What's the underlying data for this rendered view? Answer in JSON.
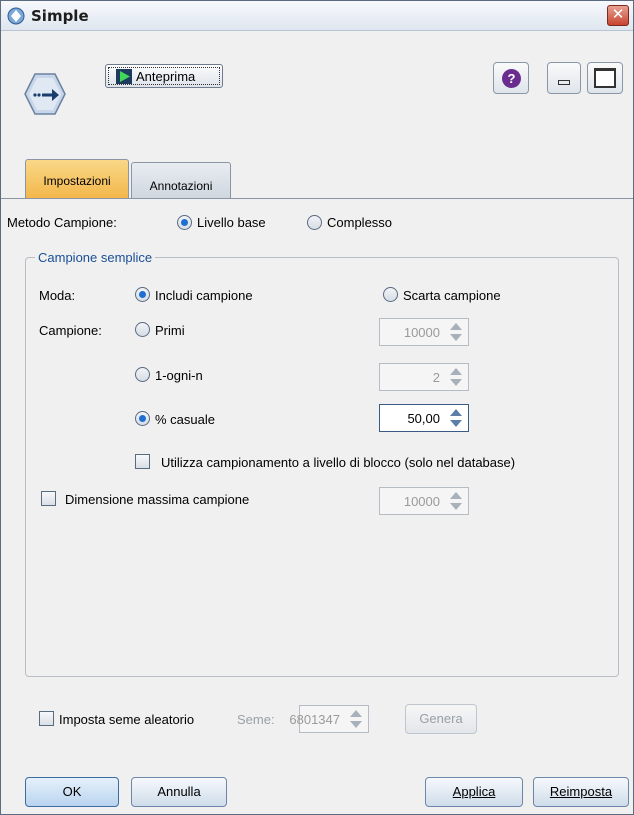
{
  "window": {
    "title": "Simple",
    "close_label": "✕"
  },
  "toolbar": {
    "preview_label": "Anteprima",
    "help_label": "?"
  },
  "tabs": [
    {
      "label": "Impostazioni",
      "active": true
    },
    {
      "label": "Annotazioni",
      "active": false
    }
  ],
  "method": {
    "label": "Metodo Campione:",
    "options": [
      {
        "label": "Livello base",
        "selected": true
      },
      {
        "label": "Complesso",
        "selected": false
      }
    ]
  },
  "simple_sample": {
    "group_title": "Campione semplice",
    "mode": {
      "label": "Moda:",
      "options": [
        {
          "label": "Includi campione",
          "selected": true
        },
        {
          "label": "Scarta campione",
          "selected": false
        }
      ]
    },
    "sample": {
      "label": "Campione:",
      "options": [
        {
          "label": "Primi",
          "selected": false,
          "value": "10000"
        },
        {
          "label": "1-ogni-n",
          "selected": false,
          "value": "2"
        },
        {
          "label": "% casuale",
          "selected": true,
          "value": "50,00"
        }
      ]
    },
    "block_level": {
      "label": "Utilizza campionamento a livello di blocco (solo nel database)",
      "checked": false
    },
    "max_size": {
      "label": "Dimensione massima campione",
      "checked": false,
      "value": "10000"
    }
  },
  "seed": {
    "checkbox_label": "Imposta seme aleatorio",
    "seed_label": "Seme:",
    "seed_value": "6801347",
    "generate_label": "Genera"
  },
  "buttons": {
    "ok": "OK",
    "cancel": "Annulla",
    "apply": "Applica",
    "reset": "Reimposta"
  },
  "colors": {
    "active_tab": "#f3b649",
    "radio_dot": "#1f6fd1",
    "group_title": "#1a4f96"
  }
}
